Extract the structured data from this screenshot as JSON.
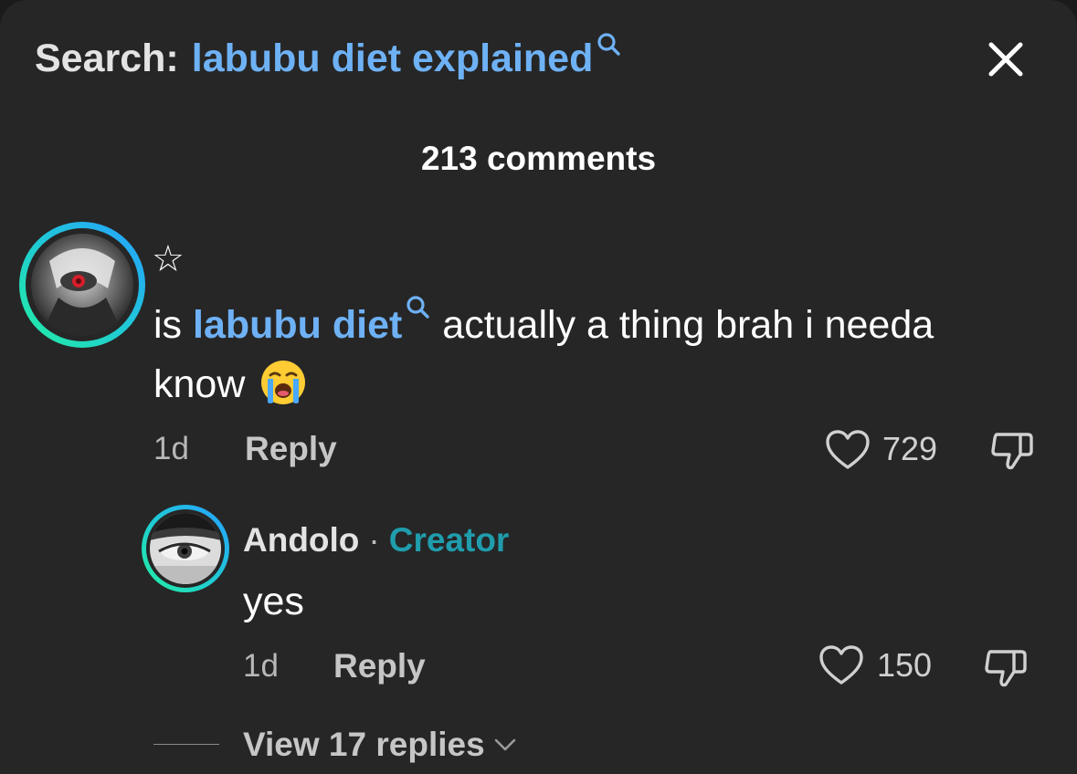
{
  "header": {
    "search_prefix": "Search:",
    "search_query": "labubu diet explained",
    "close_icon": "close-icon"
  },
  "comments_count_label": "213 comments",
  "comment": {
    "username": "☆",
    "text_prefix": "is ",
    "text_link": "labubu diet",
    "text_suffix": " actually a thing brah i needa",
    "text_line2": "know",
    "emoji": "loudly-crying-face",
    "time": "1d",
    "reply_label": "Reply",
    "likes": "729"
  },
  "reply": {
    "author": "Andolo",
    "separator": "·",
    "badge": "Creator",
    "text": "yes",
    "time": "1d",
    "reply_label": "Reply",
    "likes": "150"
  },
  "view_replies_label": "View 17 replies",
  "colors": {
    "background": "#262626",
    "link": "#6eb1f5",
    "creator": "#1f9dad",
    "ring_start": "#27a0ff",
    "ring_end": "#24f0a0"
  }
}
